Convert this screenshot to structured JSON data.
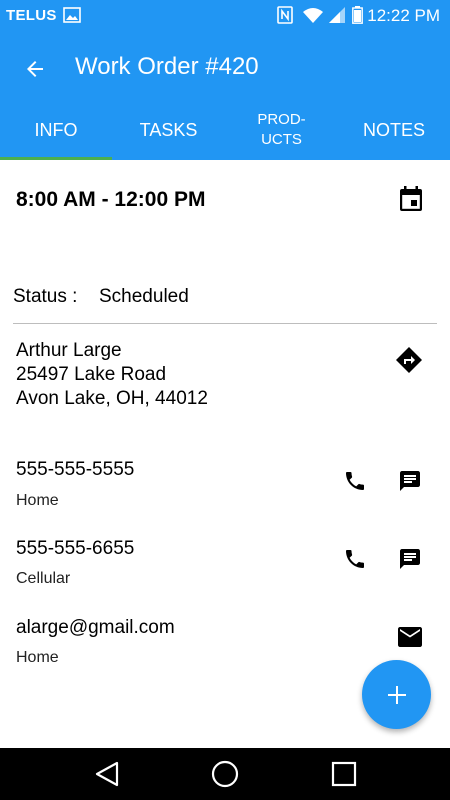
{
  "status_bar": {
    "carrier": "TELUS",
    "time": "12:22 PM",
    "icons": [
      "image-icon",
      "nfc-icon",
      "wifi-icon",
      "signal-icon",
      "battery-icon"
    ]
  },
  "app_bar": {
    "title": "Work Order #420",
    "back_icon": "arrow-back-icon",
    "background": "#2196f3",
    "tab_indicator_color": "#4caf50"
  },
  "tabs": [
    {
      "label": "INFO",
      "selected": true
    },
    {
      "label": "TASKS",
      "selected": false
    },
    {
      "label": "PROD-\nUCTS",
      "selected": false
    },
    {
      "label": "NOTES",
      "selected": false
    }
  ],
  "schedule": {
    "time_range": "8:00 AM - 12:00 PM",
    "icon": "calendar-icon"
  },
  "status": {
    "label": "Status :",
    "value": "Scheduled"
  },
  "address": {
    "name": "Arthur Large",
    "street": "25497 Lake Road",
    "city_line": "Avon Lake, OH, 44012",
    "icon": "directions-icon"
  },
  "contacts": [
    {
      "value": "555-555-5555",
      "type": "Home",
      "icons": [
        "phone-icon",
        "message-icon"
      ]
    },
    {
      "value": "555-555-6655",
      "type": "Cellular",
      "icons": [
        "phone-icon",
        "message-icon"
      ]
    },
    {
      "value": "alarge@gmail.com",
      "type": "Home",
      "icons": [
        "email-icon"
      ]
    }
  ],
  "fab": {
    "icon": "add-icon",
    "color": "#2196f3"
  },
  "nav_bar": {
    "icons": [
      "nav-back-icon",
      "home-icon",
      "recents-icon"
    ]
  }
}
